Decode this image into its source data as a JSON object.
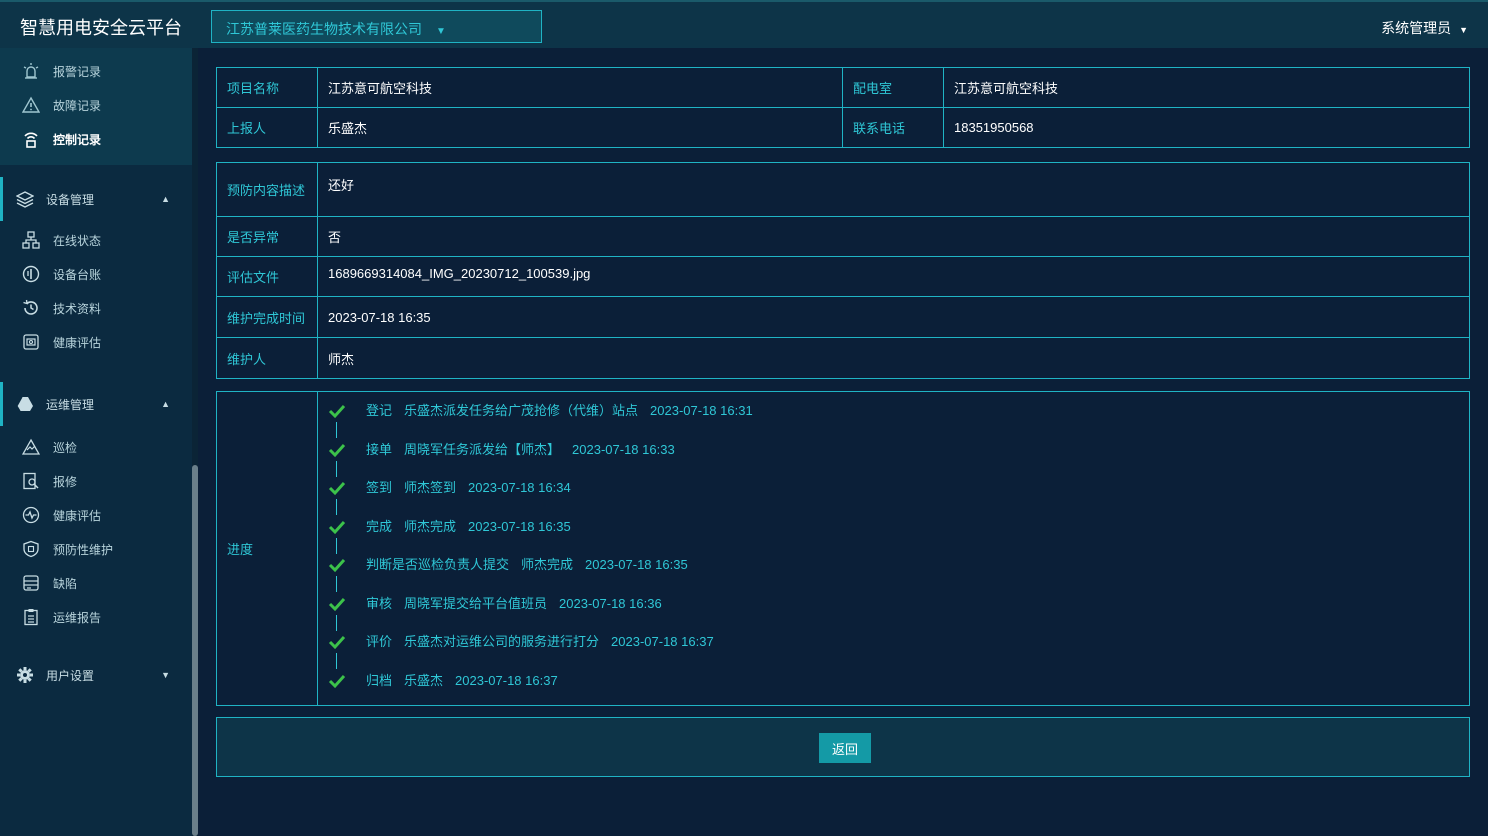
{
  "header": {
    "app_title": "智慧用电安全云平台",
    "company_selected": "江苏普莱医药生物技术有限公司",
    "user_label": "系统管理员"
  },
  "sidebar": {
    "top_items": [
      {
        "label": "报警记录",
        "icon": "alarm-light-icon"
      },
      {
        "label": "故障记录",
        "icon": "warning-triangle-icon"
      },
      {
        "label": "控制记录",
        "icon": "remote-control-icon",
        "active": true
      }
    ],
    "groups": [
      {
        "label": "设备管理",
        "icon": "layers-icon",
        "expanded": true,
        "items": [
          {
            "label": "在线状态",
            "icon": "network-icon"
          },
          {
            "label": "设备台账",
            "icon": "ledger-icon"
          },
          {
            "label": "技术资料",
            "icon": "history-icon"
          },
          {
            "label": "健康评估",
            "icon": "camera-box-icon"
          }
        ]
      },
      {
        "label": "运维管理",
        "icon": "drive-icon",
        "expanded": true,
        "items": [
          {
            "label": "巡检",
            "icon": "inspect-icon"
          },
          {
            "label": "报修",
            "icon": "repair-report-icon"
          },
          {
            "label": "健康评估",
            "icon": "heartbeat-icon"
          },
          {
            "label": "预防性维护",
            "icon": "shield-icon"
          },
          {
            "label": "缺陷",
            "icon": "defect-icon"
          },
          {
            "label": "运维报告",
            "icon": "report-icon"
          }
        ]
      },
      {
        "label": "用户设置",
        "icon": "gear-icon",
        "expanded": false,
        "items": []
      }
    ]
  },
  "info": {
    "project_label": "项目名称",
    "project_value": "江苏意可航空科技",
    "room_label": "配电室",
    "room_value": "江苏意可航空科技",
    "reporter_label": "上报人",
    "reporter_value": "乐盛杰",
    "phone_label": "联系电话",
    "phone_value": "18351950568"
  },
  "detail": {
    "desc_label": "预防内容描述",
    "desc_value": "还好",
    "abnormal_label": "是否异常",
    "abnormal_value": "否",
    "file_label": "评估文件",
    "file_value": "1689669314084_IMG_20230712_100539.jpg",
    "done_time_label": "维护完成时间",
    "done_time_value": "2023-07-18 16:35",
    "maintainer_label": "维护人",
    "maintainer_value": "师杰"
  },
  "progress": {
    "label": "进度",
    "steps": [
      {
        "action": "登记",
        "desc": "乐盛杰派发任务给广茂抢修（代维）站点",
        "time": "2023-07-18 16:31"
      },
      {
        "action": "接单",
        "desc": "周晓军任务派发给【师杰】",
        "time": "2023-07-18 16:33"
      },
      {
        "action": "签到",
        "desc": "师杰签到",
        "time": "2023-07-18 16:34"
      },
      {
        "action": "完成",
        "desc": "师杰完成",
        "time": "2023-07-18 16:35"
      },
      {
        "action": "判断是否巡检负责人提交",
        "desc": "师杰完成",
        "time": "2023-07-18 16:35"
      },
      {
        "action": "审核",
        "desc": "周晓军提交给平台值班员",
        "time": "2023-07-18 16:36"
      },
      {
        "action": "评价",
        "desc": "乐盛杰对运维公司的服务进行打分",
        "time": "2023-07-18 16:37"
      },
      {
        "action": "归档",
        "desc": "乐盛杰",
        "time": "2023-07-18 16:37"
      }
    ]
  },
  "footer": {
    "back_label": "返回"
  },
  "colors": {
    "accent": "#1fb3c4",
    "background": "#0b1f38",
    "check": "#3cc24a"
  }
}
